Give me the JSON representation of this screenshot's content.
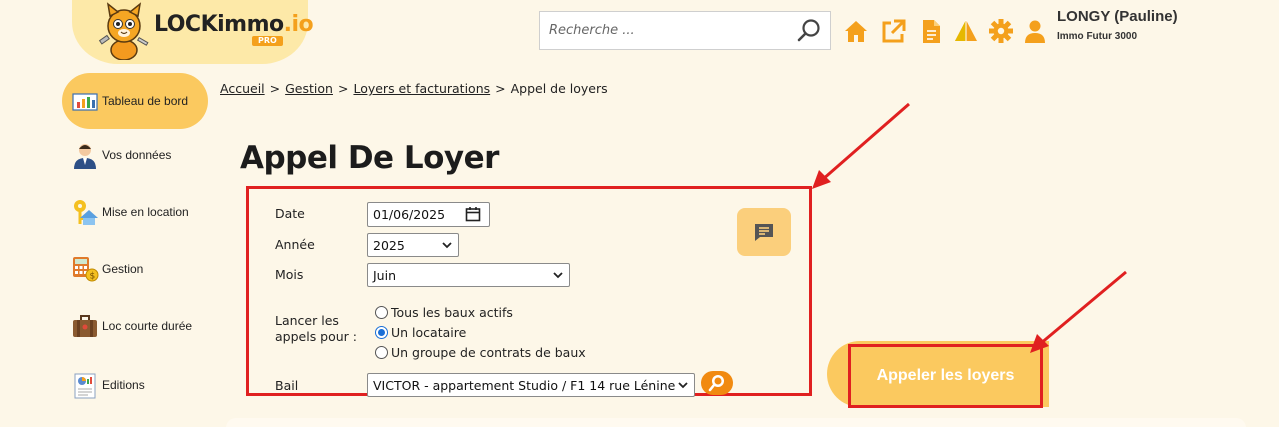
{
  "header": {
    "brand_main": "LOCKimmo",
    "brand_suffix": ".io",
    "brand_badge": "PRO",
    "search_placeholder": "Recherche ...",
    "user_name": "LONGY (Pauline)",
    "user_agency": "Immo Futur 3000",
    "accent": "#f4a01c"
  },
  "sidebar": {
    "items": [
      {
        "label": "Tableau de bord",
        "icon": "dashboard-icon",
        "active": true
      },
      {
        "label": "Vos données",
        "icon": "user-person-icon"
      },
      {
        "label": "Mise en location",
        "icon": "key-house-icon"
      },
      {
        "label": "Gestion",
        "icon": "calculator-money-icon"
      },
      {
        "label": "Loc courte durée",
        "icon": "suitcase-icon"
      },
      {
        "label": "Editions",
        "icon": "report-chart-icon"
      }
    ]
  },
  "breadcrumb": {
    "items": [
      "Accueil",
      "Gestion",
      "Loyers et facturations"
    ],
    "current": "Appel de loyers",
    "separator": ">"
  },
  "page": {
    "title": "Appel De Loyer"
  },
  "form": {
    "date_label": "Date",
    "date_value": "01/06/2025",
    "annee_label": "Année",
    "annee_value": "2025",
    "mois_label": "Mois",
    "mois_value": "Juin",
    "lancer_label_1": "Lancer les",
    "lancer_label_2": "appels pour :",
    "radio_options": [
      {
        "label": "Tous les baux actifs",
        "checked": false
      },
      {
        "label": "Un locataire",
        "checked": true
      },
      {
        "label": "Un groupe de contrats de baux",
        "checked": false
      }
    ],
    "bail_label": "Bail",
    "bail_value": "VICTOR - appartement Studio / F1 14 rue Lénine"
  },
  "actions": {
    "call_button_label": "Appeler les loyers"
  },
  "colors": {
    "highlight_red": "#e02020",
    "button_yellow": "#fbc95f",
    "bg": "#fdf7e8",
    "icon_orange": "#f4a01c"
  }
}
